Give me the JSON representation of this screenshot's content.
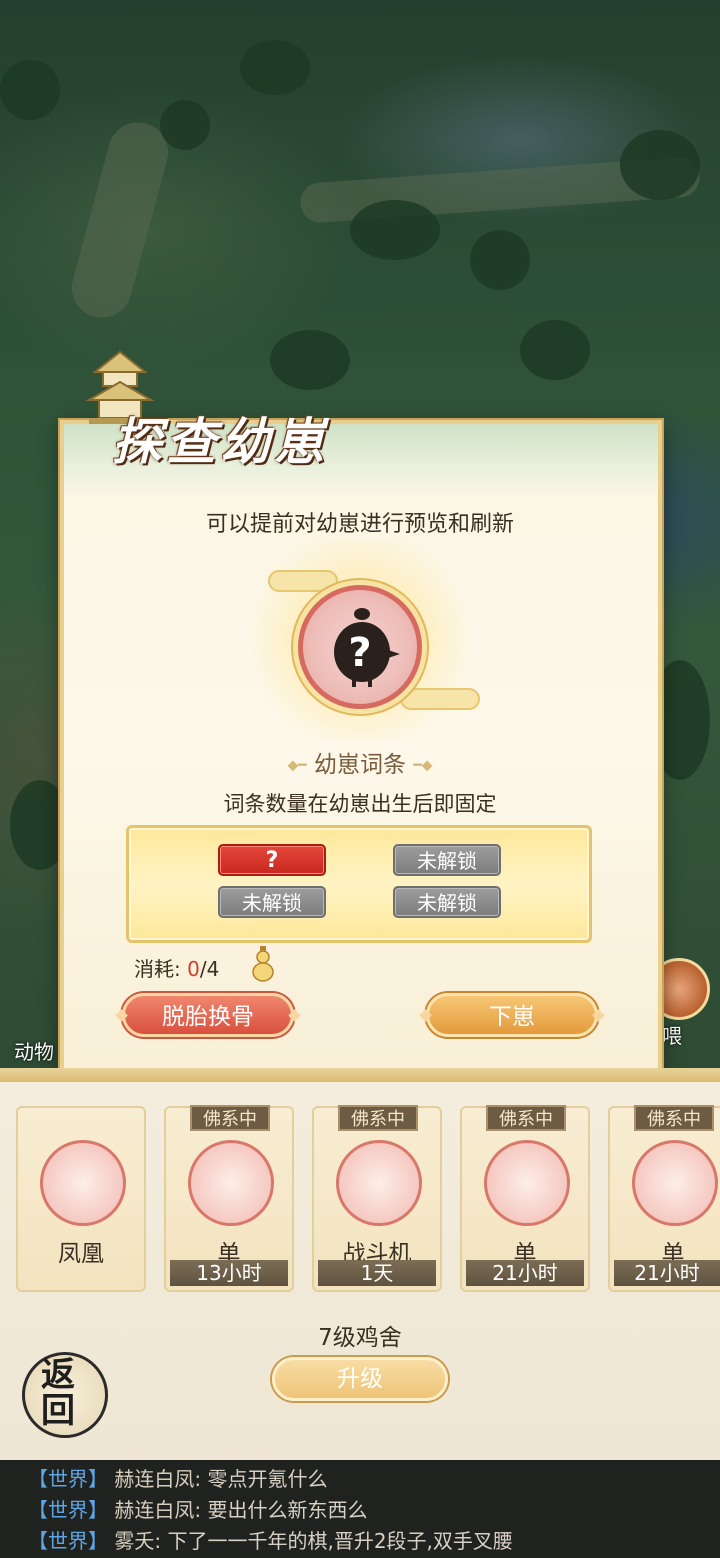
{
  "dialog": {
    "title": "探查幼崽",
    "subtitle": "可以提前对幼崽进行预览和刷新",
    "unknown_mark": "?",
    "section_label": "幼崽词条",
    "section_hint": "词条数量在幼崽出生后即固定",
    "traits": [
      {
        "label": "?",
        "state": "active"
      },
      {
        "label": "未解锁",
        "state": "locked"
      },
      {
        "label": "未解锁",
        "state": "locked"
      },
      {
        "label": "未解锁",
        "state": "locked"
      }
    ],
    "cost_label": "消耗:",
    "cost_current": "0",
    "cost_total": "/4",
    "reroll_button": "脱胎换骨",
    "hatch_button": "下崽"
  },
  "side": {
    "left_label": "动物",
    "right_label": "喂"
  },
  "animals": [
    {
      "tag": "",
      "name": "凤凰",
      "timer": ""
    },
    {
      "tag": "佛系中",
      "name": "单",
      "timer": "13小时"
    },
    {
      "tag": "佛系中",
      "name": "战斗机",
      "timer": "1天"
    },
    {
      "tag": "佛系中",
      "name": "单",
      "timer": "21小时"
    },
    {
      "tag": "佛系中",
      "name": "单",
      "timer": "21小时"
    }
  ],
  "coop": {
    "level_text": "7级鸡舍",
    "upgrade_button": "升级",
    "back_button": "返回"
  },
  "chat": [
    {
      "channel": "【世界】",
      "user": "赫连白凤:",
      "message": "零点开氪什么"
    },
    {
      "channel": "【世界】",
      "user": "赫连白凤:",
      "message": "要出什么新东西么"
    },
    {
      "channel": "【世界】",
      "user": "雾夭:",
      "message": "下了一一千年的棋,晋升2段子,双手叉腰"
    }
  ],
  "colors": {
    "accent_red": "#d8503d",
    "accent_orange": "#e39a3c",
    "locked_gray": "#7c7c7c",
    "chat_channel": "#5da6e6"
  }
}
